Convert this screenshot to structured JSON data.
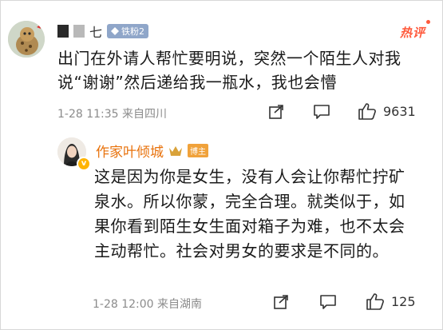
{
  "comment": {
    "username": "七",
    "badge_label": "铁粉2",
    "hot_label": "热评",
    "text": "出门在外请人帮忙要明说，突然一个陌生人对我说“谢谢”然后递给我一瓶水，我也会懵",
    "meta": "1-28 11:35 来自四川",
    "like_count": "9631"
  },
  "reply": {
    "username": "作家叶倾城",
    "author_label": "博主",
    "text": "这是因为你是女生，没有人会让你帮忙拧矿泉水。所以你蒙，完全合理。就类似于，如果你看到陌生女生面对箱子为难，也不太会主动帮忙。社会对男女的要求是不同的。",
    "meta": "1-28 12:00 来自湖南",
    "like_count": "125"
  },
  "icons": [
    "avatar",
    "share-icon",
    "comment-icon",
    "like-icon",
    "crown-icon",
    "verified-icon"
  ],
  "colors": {
    "hot": "#ff5a3c",
    "reply_name": "#e8720c",
    "meta": "#8b8b8b"
  }
}
